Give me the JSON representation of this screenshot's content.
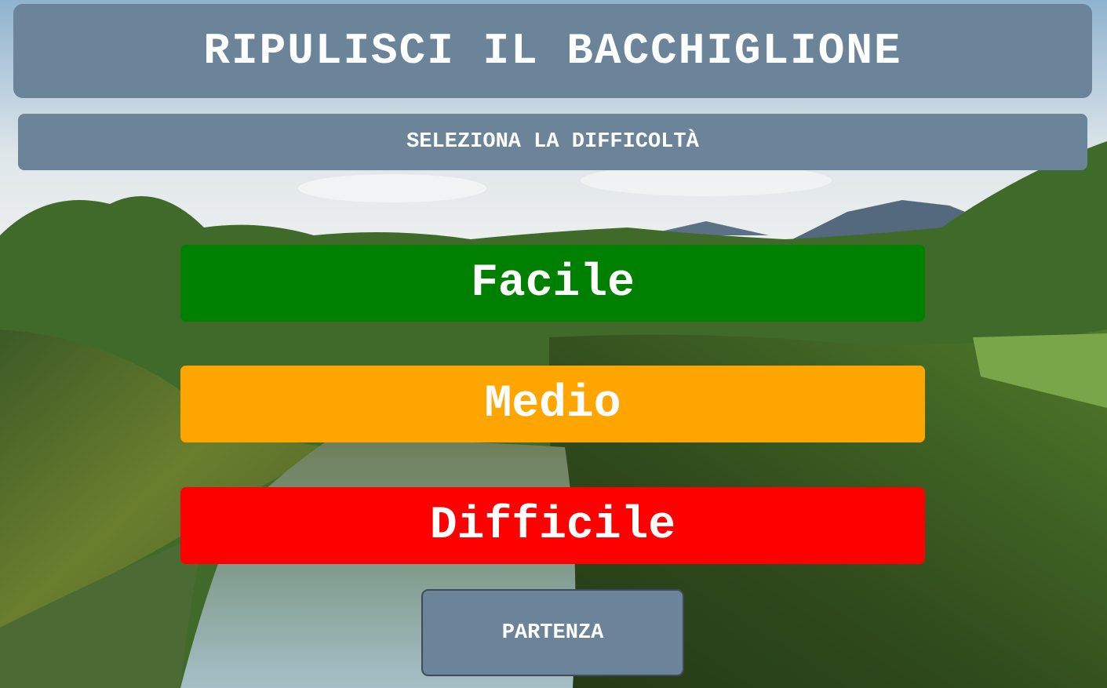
{
  "header": {
    "title": "RIPULISCI IL BACCHIGLIONE",
    "subtitle": "SELEZIONA LA DIFFICOLTÀ"
  },
  "difficulty": {
    "options": [
      {
        "label": "Facile",
        "color": "#008000"
      },
      {
        "label": "Medio",
        "color": "#ffa500"
      },
      {
        "label": "Difficile",
        "color": "#ff0000"
      }
    ]
  },
  "start": {
    "label": "PARTENZA"
  },
  "colors": {
    "panel": "#6c8499",
    "text": "#ffffff"
  }
}
